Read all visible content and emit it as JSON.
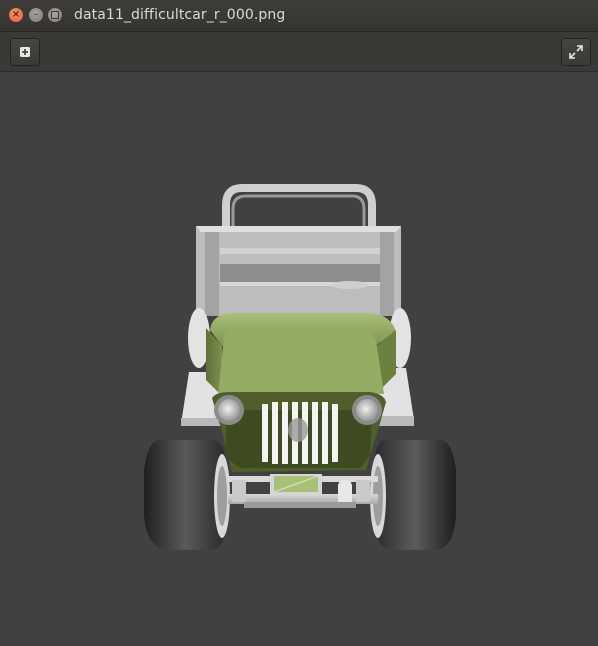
{
  "window": {
    "title": "data11_difficultcar_r_000.png",
    "controls": [
      "close",
      "minimize",
      "maximize"
    ]
  },
  "toolbar": {
    "left_button_icon": "add-icon",
    "right_button_icon": "fullscreen-icon"
  },
  "viewer": {
    "background_color": "#414141",
    "content": "3D-rendered jeep model, front view",
    "body_color": "#9bb26a"
  }
}
